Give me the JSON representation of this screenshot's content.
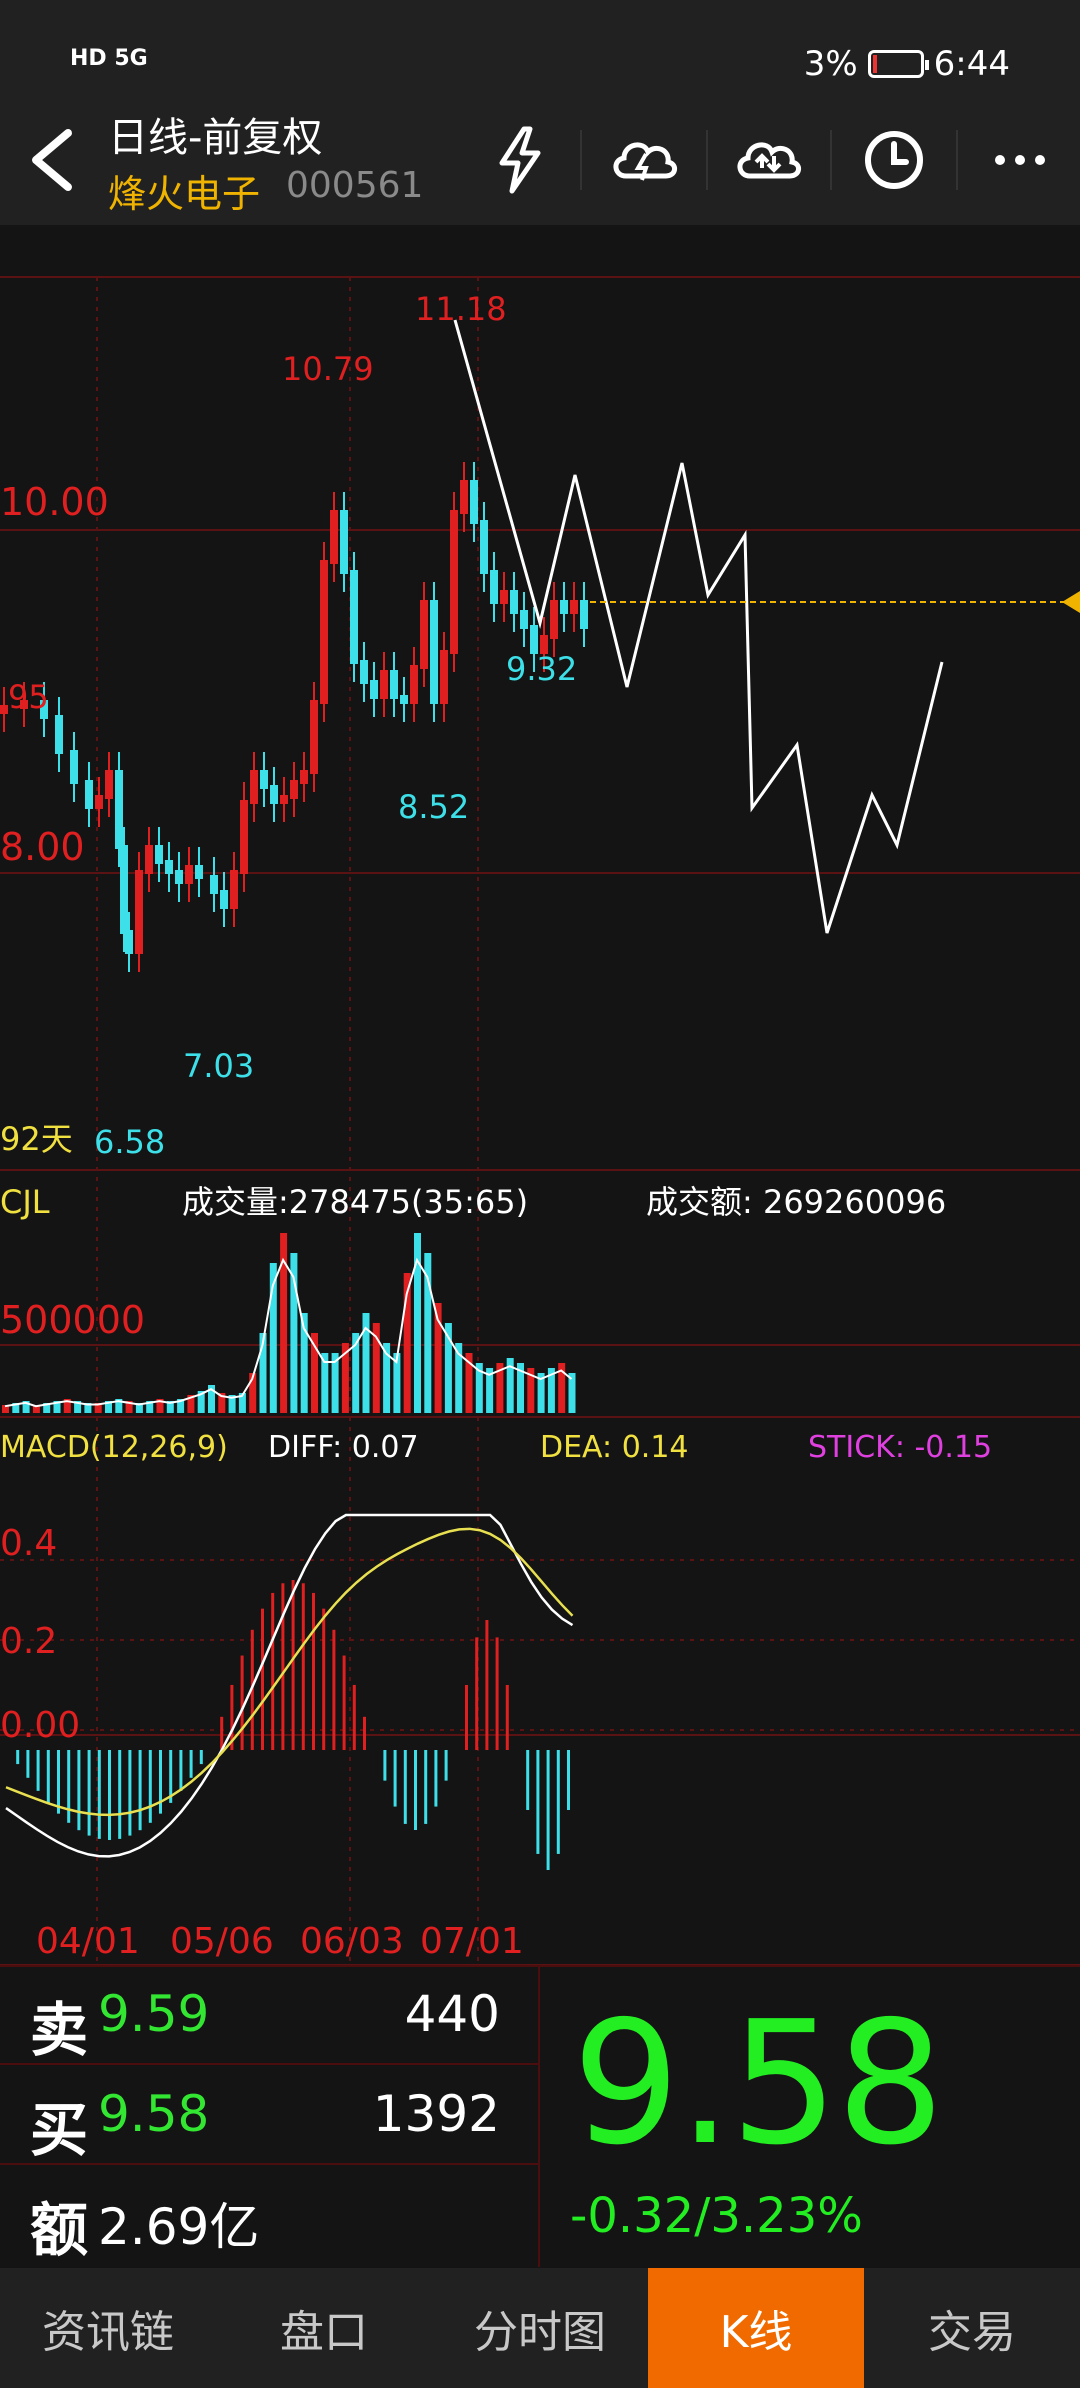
{
  "status_bar": {
    "left_text": "HD 5G",
    "battery": "3%",
    "time": "6:44"
  },
  "header": {
    "title": "日线-前复权",
    "stock_name": "烽火电子",
    "stock_code": "000561",
    "icons": [
      "lightning-icon",
      "cloud-download-icon",
      "cloud-upload-icon",
      "clock-icon",
      "more-icon"
    ]
  },
  "price_chart": {
    "y_labels": [
      "10.00",
      "8.00"
    ],
    "annotations": {
      "high": "11.18",
      "h2": "10.79",
      "left": "95",
      "l1": "9.32",
      "l2": "8.52",
      "l3": "7.03",
      "l4": "6.58"
    },
    "period_label": "92天"
  },
  "volume_chart": {
    "name": "CJL",
    "volume_text": "成交量:278475(35:65)",
    "amount_text": "成交额: 269260096",
    "y_label": "500000"
  },
  "macd_chart": {
    "name": "MACD(12,26,9)",
    "diff": "DIFF: 0.07",
    "dea": "DEA: 0.14",
    "stick": "STICK: -0.15",
    "y_labels": [
      "0.4",
      "0.2",
      "0.00"
    ]
  },
  "date_axis": [
    "04/01",
    "05/06",
    "06/03",
    "07/01"
  ],
  "quote": {
    "sell_label": "卖",
    "sell_price": "9.59",
    "sell_volume": "440",
    "buy_label": "买",
    "buy_price": "9.58",
    "buy_volume": "1392",
    "amount_label": "额",
    "amount": "2.69亿",
    "last_price": "9.58",
    "change": "-0.32/3.23%"
  },
  "bottom_nav": [
    "资讯链",
    "盘口",
    "分时图",
    "K线",
    "交易"
  ],
  "colors": {
    "up": "#e02020",
    "down": "#3de0e8",
    "accent": "#f06a00",
    "gold": "#f0b400",
    "green": "#22ee22"
  }
}
